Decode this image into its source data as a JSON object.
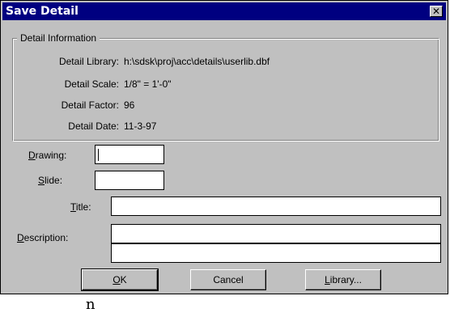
{
  "window": {
    "title": "Save Detail",
    "close_symbol": "✕"
  },
  "group": {
    "legend": "Detail Information",
    "rows": [
      {
        "label": "Detail Library:",
        "value": "h:\\sdsk\\proj\\acc\\details\\userlib.dbf"
      },
      {
        "label": "Detail Scale:",
        "value": "1/8\" = 1'-0\""
      },
      {
        "label": "Detail Factor:",
        "value": "96"
      },
      {
        "label": "Detail Date:",
        "value": "11-3-97"
      }
    ]
  },
  "form": {
    "drawing": {
      "label_first": "D",
      "label_rest": "rawing:",
      "value": ""
    },
    "slide": {
      "label_first": "S",
      "label_rest": "lide:",
      "value": ""
    },
    "title": {
      "label_first": "T",
      "label_rest": "itle:",
      "value": ""
    },
    "description": {
      "label_first": "D",
      "label_rest": "escription:",
      "value_line1": "",
      "value_line2": ""
    }
  },
  "buttons": {
    "ok": {
      "first": "O",
      "rest": "K"
    },
    "cancel": "Cancel",
    "library": {
      "first": "L",
      "rest": "ibrary..."
    }
  },
  "stray_text": "n"
}
